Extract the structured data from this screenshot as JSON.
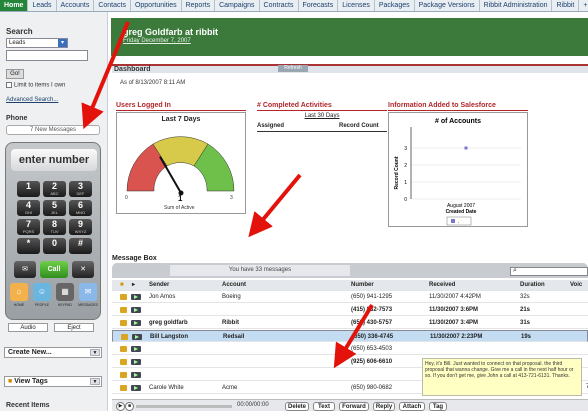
{
  "tabs": [
    "Home",
    "Leads",
    "Accounts",
    "Contacts",
    "Opportunities",
    "Reports",
    "Campaigns",
    "Contracts",
    "Forecasts",
    "Licenses",
    "Packages",
    "Package Versions",
    "Ribbit Administration",
    "Ribbit"
  ],
  "tabs_more": "+",
  "sidebar": {
    "search_label": "Search",
    "search_scope": "Leads",
    "go_label": "Go!",
    "limit_label": "Limit to items I own",
    "advanced_label": "Advanced Search...",
    "phone_label": "Phone",
    "new_messages": "7 New Messages",
    "display": "enter number",
    "keys": [
      {
        "d": "1",
        "l": ""
      },
      {
        "d": "2",
        "l": "ABC"
      },
      {
        "d": "3",
        "l": "DEF"
      },
      {
        "d": "4",
        "l": "GHI"
      },
      {
        "d": "5",
        "l": "JKL"
      },
      {
        "d": "6",
        "l": "MNO"
      },
      {
        "d": "7",
        "l": "PQRS"
      },
      {
        "d": "8",
        "l": "TUV"
      },
      {
        "d": "9",
        "l": "WXYZ"
      },
      {
        "d": "*",
        "l": ""
      },
      {
        "d": "0",
        "l": ""
      },
      {
        "d": "#",
        "l": ""
      }
    ],
    "call_label": "Call",
    "icons": [
      {
        "label": "HOME"
      },
      {
        "label": "PEOPLE"
      },
      {
        "label": "KEYPAD"
      },
      {
        "label": "MESSAGES"
      }
    ],
    "audio_label": "Audio",
    "eject_label": "Eject",
    "create_new": "Create New...",
    "view_tags": "View Tags",
    "recent_items": "Recent Items"
  },
  "header": {
    "title": "greg Goldfarb at ribbit",
    "subtitle": "Friday December 7, 2007"
  },
  "dashboard": {
    "label": "Dashboard",
    "refresh": "Refresh",
    "as_of": "As of 8/13/2007 8:11 AM",
    "users_title": "Users Logged In",
    "gauge_title": "Last 7 Days",
    "gauge_min": "0",
    "gauge_max": "3",
    "gauge_value": "1",
    "gauge_value_num": 1,
    "gauge_caption": "Sum of Active",
    "activities_title": "# Completed Activities",
    "activities_sub": "Last 30 Days",
    "col_assigned": "Assigned",
    "col_record": "Record Count",
    "info_title": "Information Added to Salesforce"
  },
  "chart_data": {
    "type": "scatter",
    "title": "# of Accounts",
    "xlabel": "Created Date",
    "ylabel": "Record Count",
    "x": [
      "August 2007"
    ],
    "values": [
      3
    ],
    "ylim": [
      0,
      4
    ],
    "yticks": [
      "0",
      "1",
      "2",
      "3"
    ],
    "grid": true,
    "legend": "bottom"
  },
  "messages": {
    "title": "Message Box",
    "count_text": "You have 33 messages",
    "headers": {
      "sender": "Sender",
      "account": "Account",
      "number": "Number",
      "received": "Received",
      "duration": "Duration",
      "voice": "Voic"
    },
    "rows": [
      {
        "sender": "Jon Amos",
        "account": "Boeing",
        "number": "(650) 941-1295",
        "received": "11/30/2007 4:42PM",
        "duration": "32s",
        "bold": false,
        "sel": false
      },
      {
        "sender": "",
        "account": "",
        "number": "(415) 832-7573",
        "received": "11/30/2007 3:6PM",
        "duration": "21s",
        "bold": true,
        "sel": false
      },
      {
        "sender": "greg goldfarb",
        "account": "Ribbit",
        "number": "(650) 430-5757",
        "received": "11/30/2007 3:4PM",
        "duration": "31s",
        "bold": true,
        "sel": false
      },
      {
        "sender": "Bill Langston",
        "account": "Redsail",
        "number": "(650) 336-4745",
        "received": "11/30/2007 2:23PM",
        "duration": "19s",
        "bold": true,
        "sel": true
      },
      {
        "sender": "",
        "account": "",
        "number": "(650) 653-4503",
        "received": "",
        "duration": "",
        "bold": false,
        "sel": false
      },
      {
        "sender": "",
        "account": "",
        "number": "(925) 606-6610",
        "received": "",
        "duration": "",
        "bold": true,
        "sel": false
      },
      {
        "sender": "",
        "account": "",
        "number": "",
        "received": "",
        "duration": "",
        "bold": false,
        "sel": false
      },
      {
        "sender": "Carole White",
        "account": "Acme",
        "number": "(650) 980-0682",
        "received": "",
        "duration": "",
        "bold": false,
        "sel": false
      }
    ],
    "tooltip": "Hey, it's Bill. Just wanted to connect on that proposal. the third proposal that wanna change. Give me a call in the next half hour or so. If you don't get me, give John a call at 413-721-6131. Thanks.",
    "tooltip_extra": "7s",
    "player_time": "00:00/00:00",
    "actions": [
      "Delete",
      "Text",
      "Forward",
      "Reply",
      "Attach",
      "Tag"
    ]
  },
  "colors": {
    "accent_green": "#3c7a3c",
    "tab_active": "#23843a",
    "arrow_red": "#e3120b",
    "selected_row": "#c3dcf2",
    "panel_title": "#b2262b"
  }
}
